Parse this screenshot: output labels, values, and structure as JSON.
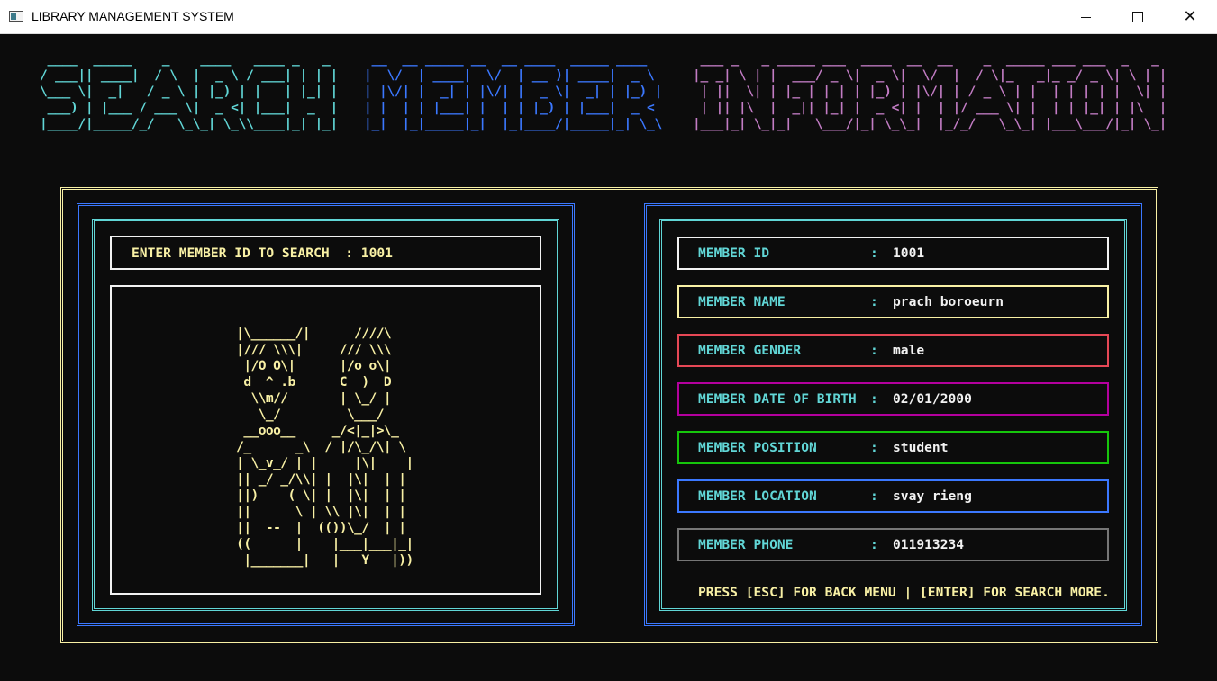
{
  "window": {
    "title": "LIBRARY MANAGEMENT SYSTEM",
    "minimize_glyph": "",
    "close_glyph": "✕"
  },
  "banner": {
    "part1": " ____  _____    _    ____   ____ _   _ \n/ ___|| ____|  / \\  |  _ \\ / ___| | | |\n\\___ \\|  _|   / _ \\ | |_) | |   | |_| |\n ___) | |___ / ___ \\|  _ <| |___|  _  |\n|____/|_____/_/   \\_\\_| \\_\\\\____|_| |_|",
    "part2": " __  __ _____ __  __ ____  _____ ____  \n|  \\/  | ____|  \\/  | __ )| ____|  _ \\ \n| |\\/| |  _| | |\\/| |  _ \\|  _| | |_) |\n| |  | | |___| |  | | |_) | |___|  _ < \n|_|  |_|_____|_|  |_|____/|_____|_| \\_\\",
    "part3": " ___ _   _ _____ ___  ____  __  __    _  _____ ___ ___  _   _ \n|_ _| \\ | |  ___/ _ \\|  _ \\|  \\/  |  / \\|_   _|_ _/ _ \\| \\ | |\n | ||  \\| | |_ | | | | |_) | |\\/| | / _ \\ | |  | | | | |  \\| |\n | || |\\  |  _|| |_| |  _ <| |  | |/ ___ \\| |  | | |_| | |\\  |\n|___|_| \\_|_|   \\___/|_| \\_\\_|  |_/_/   \\_\\_| |___\\___/|_| \\_|"
  },
  "search": {
    "label": "ENTER MEMBER ID TO SEARCH  : 1001"
  },
  "art": " |\\______/|      ////\\\n |/// \\\\\\|     /// \\\\\\\n  |/O O\\|      |/o o\\|\n  d  ^ .b      C  )  D\n   \\\\m//       | \\_/ |\n    \\_/         \\___/\n  __ooo__     _/<|_|>\\_\n /_      _\\  / |/\\_/\\| \\\n | \\_v_/ | |     |\\|    |\n || _/ _/\\\\| |  |\\|  | |\n ||)    ( \\| |  |\\|  | |\n ||      \\ | \\\\ |\\|  | |\n ||  --  |  (())\\_/  | |\n ((      |    |___|___|_|\n  |_______|   |   Y   |))",
  "member": {
    "fields": [
      {
        "label": "MEMBER ID",
        "value": "1001"
      },
      {
        "label": "MEMBER NAME",
        "value": "prach boroeurn"
      },
      {
        "label": "MEMBER GENDER",
        "value": "male"
      },
      {
        "label": "MEMBER DATE OF BIRTH",
        "value": "02/01/2000"
      },
      {
        "label": "MEMBER POSITION",
        "value": "student"
      },
      {
        "label": "MEMBER LOCATION",
        "value": "svay rieng"
      },
      {
        "label": "MEMBER PHONE",
        "value": "011913234"
      }
    ],
    "colon": ":"
  },
  "footer": {
    "hint": "PRESS [ESC] FOR BACK MENU | [ENTER] FOR SEARCH MORE."
  },
  "colors": {
    "background": "#0c0c0c",
    "yellow": "#f9f1a5",
    "cyan": "#61d6d6",
    "blue": "#3b78ff",
    "magenta": "#b4009e",
    "red": "#e74856",
    "green": "#16c60c",
    "gray": "#767676"
  }
}
